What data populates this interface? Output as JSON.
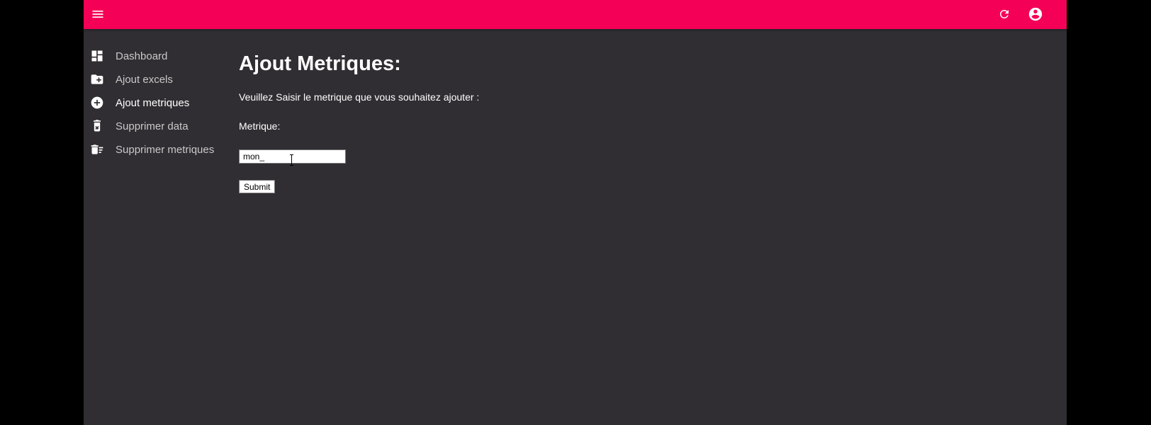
{
  "colors": {
    "accent": "#f50057",
    "background": "#302e32",
    "outer": "#000000"
  },
  "topbar": {
    "menu_icon": "menu-icon",
    "refresh_icon": "refresh-icon",
    "account_icon": "account-circle-icon"
  },
  "sidebar": {
    "items": [
      {
        "label": "Dashboard",
        "icon": "dashboard-icon",
        "active": false
      },
      {
        "label": "Ajout excels",
        "icon": "folder-add-icon",
        "active": false
      },
      {
        "label": "Ajout metriques",
        "icon": "add-circle-icon",
        "active": true
      },
      {
        "label": "Supprimer data",
        "icon": "delete-box-icon",
        "active": false
      },
      {
        "label": "Supprimer metriques",
        "icon": "delete-sweep-icon",
        "active": false
      }
    ]
  },
  "main": {
    "title": "Ajout Metriques:",
    "instructions": "Veuillez Saisir le metrique que vous souhaitez ajouter :",
    "field_label": "Metrique:",
    "input_value": "mon_",
    "submit_label": "Submit"
  }
}
